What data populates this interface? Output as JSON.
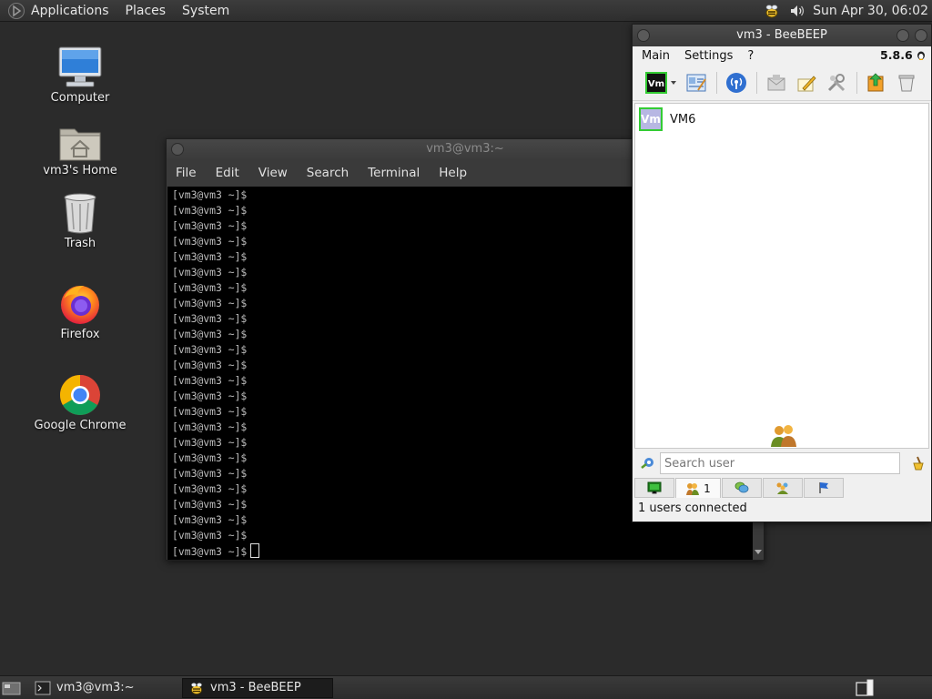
{
  "top_panel": {
    "menus": [
      "Applications",
      "Places",
      "System"
    ],
    "clock": "Sun Apr 30, 06:02",
    "tray_icons": [
      "beebeep-tray-icon",
      "volume-icon"
    ]
  },
  "desktop": {
    "icons": [
      {
        "label": "Computer",
        "icon": "computer-icon"
      },
      {
        "label": "vm3's Home",
        "icon": "home-folder-icon"
      },
      {
        "label": "Trash",
        "icon": "trash-icon"
      },
      {
        "label": "Firefox",
        "icon": "firefox-icon"
      },
      {
        "label": "Google Chrome",
        "icon": "chrome-icon"
      }
    ]
  },
  "terminal": {
    "title": "vm3@vm3:~",
    "menu": [
      "File",
      "Edit",
      "View",
      "Search",
      "Terminal",
      "Help"
    ],
    "prompt": "[vm3@vm3 ~]$",
    "line_count": 24
  },
  "beebeep": {
    "title": "vm3 - BeeBEEP",
    "menu": [
      "Main",
      "Settings",
      "?"
    ],
    "version": "5.8.6",
    "users": [
      {
        "name": "VM6",
        "avatar_text": "Vm"
      }
    ],
    "search_placeholder": "Search user",
    "tabs": [
      {
        "icon": "chat-list-icon",
        "label": ""
      },
      {
        "icon": "users-icon",
        "label": "1"
      },
      {
        "icon": "groups-icon",
        "label": ""
      },
      {
        "icon": "group-users-icon",
        "label": ""
      },
      {
        "icon": "flag-icon",
        "label": ""
      }
    ],
    "status": "1 users connected",
    "colors": {
      "avatar_border": "#33cc33",
      "avatar_bg": "#b7b7e3"
    }
  },
  "bottom_panel": {
    "tasks": [
      {
        "label": "vm3@vm3:~",
        "icon": "terminal-icon"
      },
      {
        "label": "vm3 - BeeBEEP",
        "icon": "beebeep-icon"
      }
    ]
  }
}
